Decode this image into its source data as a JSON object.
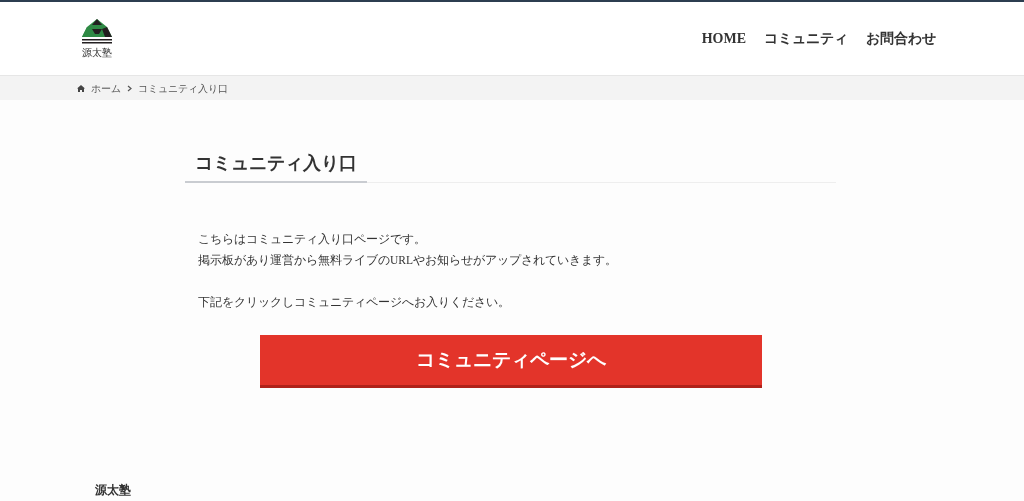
{
  "header": {
    "logo_text": "源太塾",
    "nav": [
      {
        "label": "HOME"
      },
      {
        "label": "コミュニティ"
      },
      {
        "label": "お問合わせ"
      }
    ]
  },
  "breadcrumb": [
    "ホーム",
    "コミュニティ入り口"
  ],
  "page": {
    "title": "コミュニティ入り口",
    "paragraphs": [
      [
        "こちらはコミュニティ入り口ページです。",
        "掲示板があり運営から無料ライブのURLやお知らせがアップされていきます。"
      ],
      [
        "下記をクリックしコミュニティページへお入りください。"
      ]
    ],
    "button": "コミュニティページへ"
  },
  "footer": {
    "title": "源太塾"
  }
}
